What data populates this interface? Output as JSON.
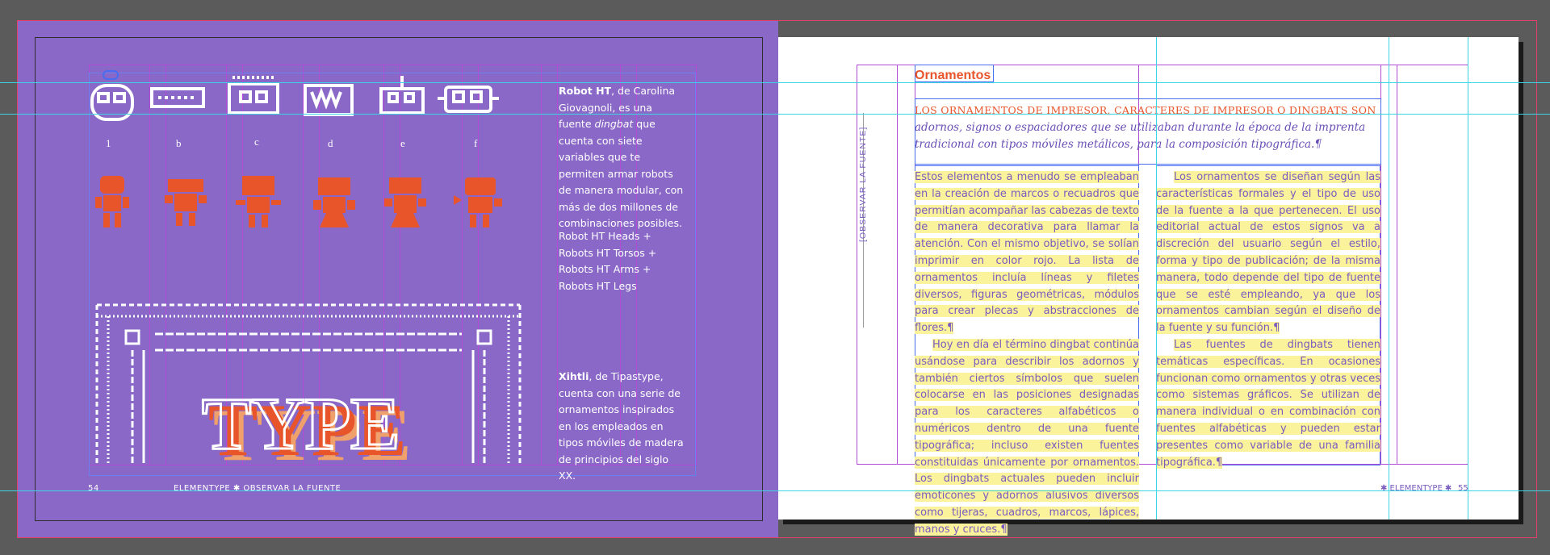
{
  "left_page": {
    "robot_letters": [
      "1",
      "b",
      "c",
      "d",
      "e",
      "f"
    ],
    "robot_ht_text": {
      "name": "Robot HT",
      "rest": ", de Carolina Giovagnoli, es una fuente",
      "italic": "dingbat",
      "rest2": " que cuenta con siete variables que te permiten armar robots de manera modular, con más de dos millones de combinaciones posibles."
    },
    "robot_ht_variants": "Robot HT Heads + Robots HT Torsos + Robots HT Arms + Robots HT Legs",
    "xihtli_text": {
      "name": "Xihtli",
      "rest": ", de Tipastype, cuenta con una serie de ornamentos inspirados en los empleados en tipos móviles de madera de principios del siglo XX."
    },
    "type_word": "TYPE",
    "folio_number": "54",
    "folio_running": "ELEMENTYPE ✱ OBSERVAR LA FUENTE",
    "colors": {
      "page": "#8a68c7",
      "orange": "#e8552b",
      "white": "#ffffff"
    }
  },
  "right_page": {
    "title": "Ornamentos",
    "side_label": "[OBSERVAR LA FUENTE]",
    "lead_caps": "LOS ORNAMENTOS DE IMPRESOR, CARACTERES DE IMPRESOR O DINGBATS SON",
    "lead_italic": "adornos, signos o espaciadores que se utilizaban durante la época de la imprenta tradicional con tipos móviles metálicos, para la composición tipográfica.¶",
    "col1_p1": "Estos elementos a menudo se empleaban en la creación de marcos o recuadros que permitían acompañar las cabezas de texto de manera decorativa para llamar la atención. Con el mismo objetivo, se solían imprimir en color rojo. La lista de ornamentos incluía líneas y filetes diversos, figuras geométricas, módulos para crear plecas y abstracciones de flores.¶",
    "col1_p2": "Hoy en día el término dingbat continúa usándose para describir los adornos y también ciertos símbolos que suelen colocarse en las posiciones designadas para los caracteres alfabéticos o numéricos dentro de una fuente tipográfica; incluso existen fuentes constituidas únicamente por ornamentos. Los dingbats actuales pueden incluir emoticones y adornos alusivos diversos como tijeras, cuadros, marcos, lápices, manos y cruces.¶",
    "col2_p1": "Los ornamentos se diseñan según las características formales y el tipo de uso de la fuente a la que pertenecen. El uso editorial actual de estos signos va a discreción del usuario según el estilo, forma y tipo de publicación; de la misma manera, todo depende del tipo de fuente que se esté empleando, ya que los ornamentos cambian según el diseño de la fuente y su función.¶",
    "col2_p2": "Las fuentes de dingbats tienen temáticas específicas. En ocasiones funcionan como ornamentos y otras veces como sistemas gráficos. Se utilizan de manera individual o en combinación con fuentes alfabéticas y pueden estar presentes como variable de una familia tipográfica.¶",
    "folio_running": "✱ ELEMENTYPE ✱",
    "folio_number": "55",
    "colors": {
      "text": "#7a5cc0",
      "highlight": "#fbf39c",
      "title": "#e8552b"
    }
  }
}
